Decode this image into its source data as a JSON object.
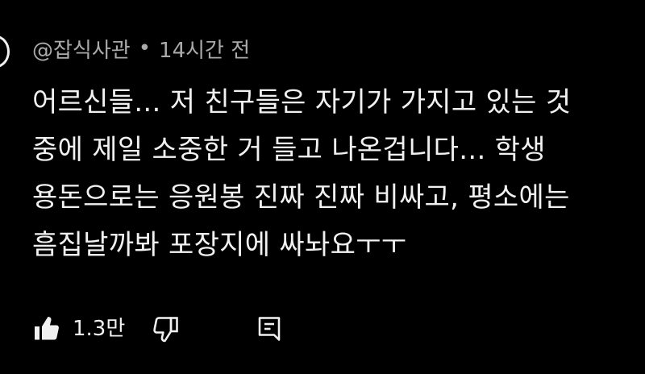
{
  "comment": {
    "author": "@잡식사관",
    "separator": "•",
    "time": "14시간 전",
    "lines": [
      "어르신들... 저 친구들은 자기가 가지고 있는 것",
      "중에 제일 소중한 거 들고 나온겁니다... 학생",
      "용돈으로는 응원봉 진짜 진짜 비싸고, 평소에는",
      "흠집날까봐 포장지에 싸놔요ㅜㅜ"
    ]
  },
  "actions": {
    "like_icon": "thumbs-up-filled-icon",
    "like_count": "1.3만",
    "dislike_icon": "thumbs-down-outline-icon",
    "reply_icon": "comment-reply-icon"
  },
  "colors": {
    "background": "#000000",
    "text": "#f1f1f1",
    "meta": "#aaaaaa"
  }
}
